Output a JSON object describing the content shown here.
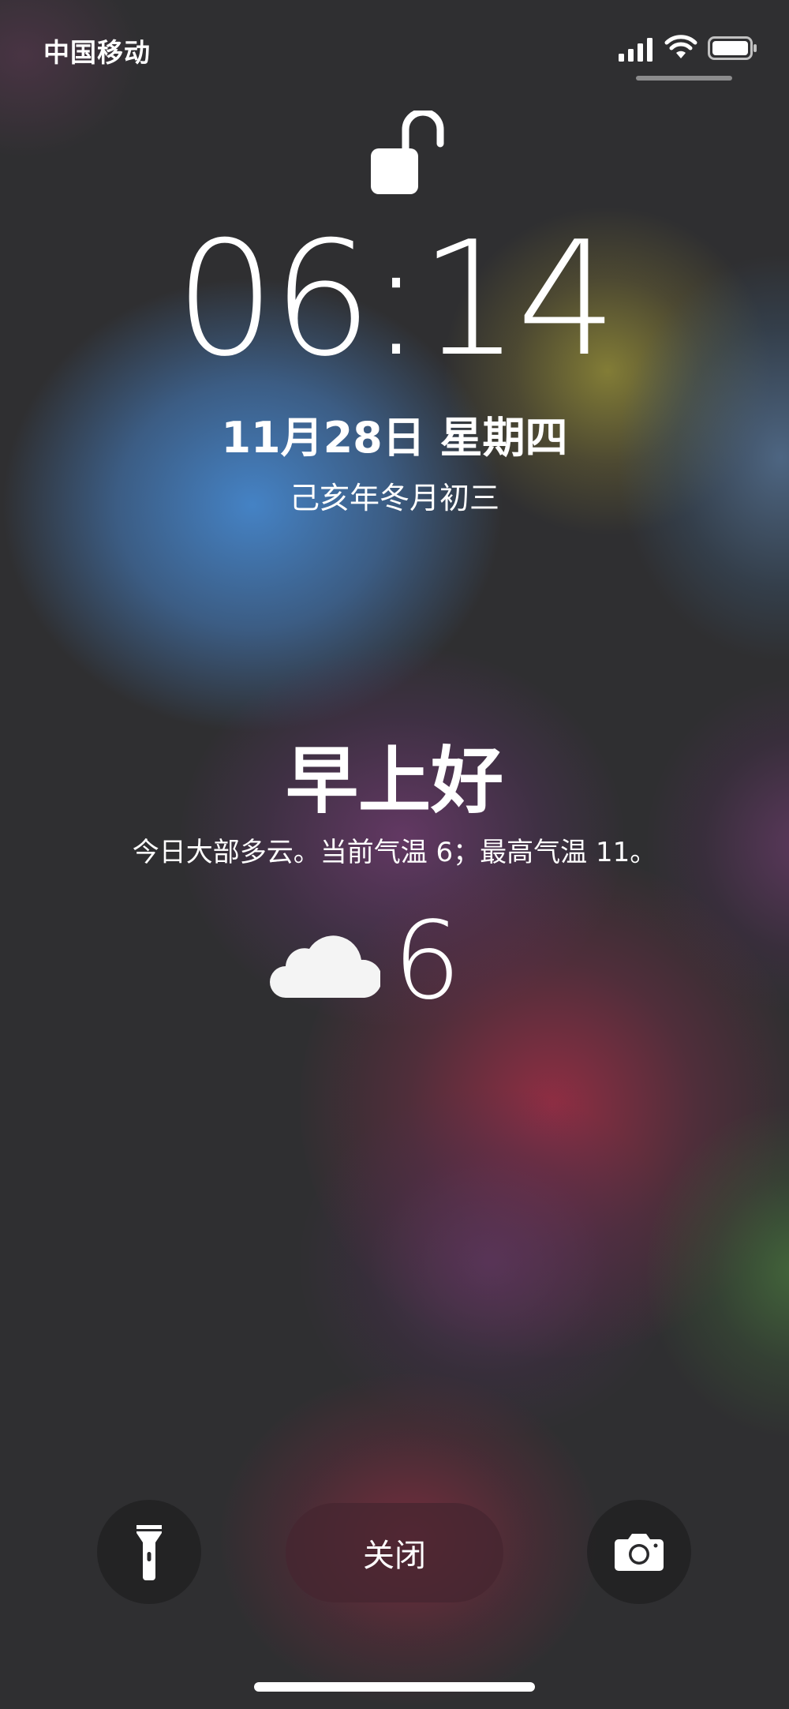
{
  "status_bar": {
    "carrier": "中国移动",
    "icons": [
      "cellular-signal-icon",
      "wifi-icon",
      "battery-icon"
    ]
  },
  "lock_screen": {
    "lock_state_icon": "unlocked-padlock-icon",
    "time": "06:14",
    "date": "11月28日 星期四",
    "lunar_date": "己亥年冬月初三"
  },
  "weather_widget": {
    "greeting": "早上好",
    "forecast": "今日大部多云。当前气温 6；最高气温 11。",
    "condition_icon": "cloud-icon",
    "current_temperature": "6"
  },
  "bottom_controls": {
    "flashlight_icon": "flashlight-icon",
    "close_label": "关闭",
    "camera_icon": "camera-icon"
  },
  "colors": {
    "background": "#2f2f31",
    "text": "#ffffff",
    "close_button_bg": "#46262f"
  }
}
